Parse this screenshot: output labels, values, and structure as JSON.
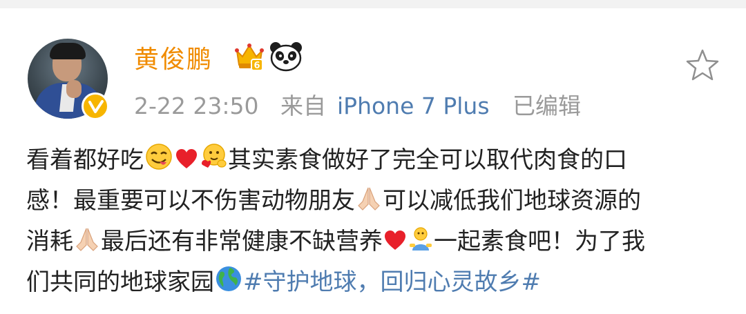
{
  "post": {
    "author": "黄俊鹏",
    "time": "2-22 23:50",
    "from_label": "来自",
    "device": "iPhone 7 Plus",
    "edited_label": "已编辑",
    "badge_level": "6"
  },
  "content": {
    "line1": {
      "a": "看着都好吃",
      "b": "其实素食做好了完全可以取代肉食的口"
    },
    "line2": {
      "a": "感！最重要可以不伤害动物朋友",
      "b": "可以减低我们地球资源的"
    },
    "line3": {
      "a": "消耗",
      "b": "最后还有非常健康不缺营养",
      "c": "一起素食吧！为了我"
    },
    "line4": {
      "a": "们共同的地球家园",
      "topic": "#守护地球，回归心灵故乡#"
    }
  },
  "icons": {
    "verified": "verified-v-badge-icon",
    "crown": "member-crown-icon",
    "panda": "panda-icon",
    "favorite": "star-outline-icon",
    "emojis": [
      "yum-face-icon",
      "red-heart-icon",
      "hug-face-icon",
      "praying-hands-icon",
      "praying-hands-icon",
      "red-heart-icon",
      "person-icon",
      "globe-icon"
    ]
  },
  "colors": {
    "author": "#f08b00",
    "link": "#4f7cb0",
    "meta": "#9a9a9a",
    "text": "#222222",
    "badge": "#f7b500"
  }
}
